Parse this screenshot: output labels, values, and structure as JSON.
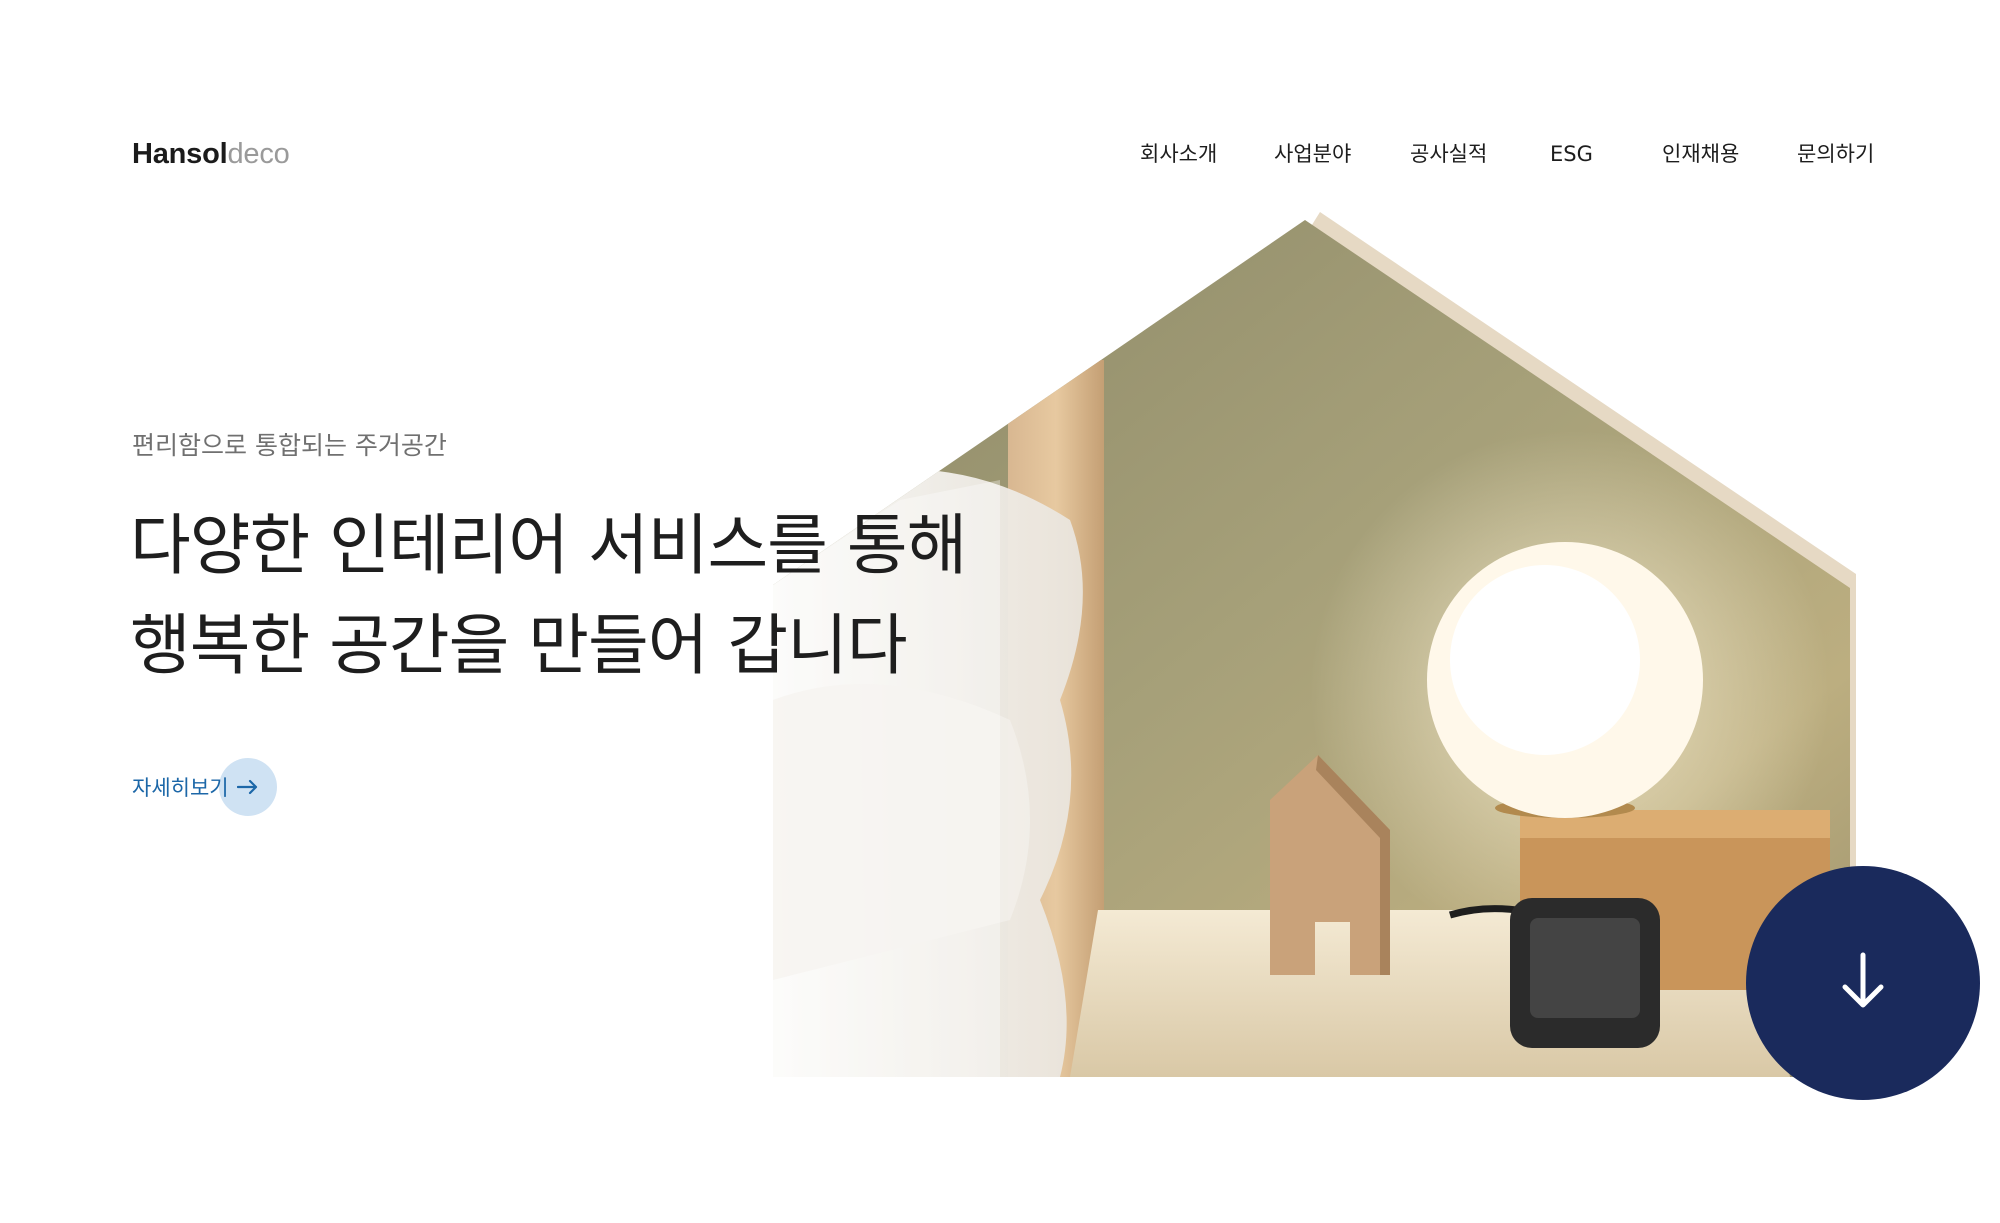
{
  "brand": {
    "logo_primary": "Hansol",
    "logo_secondary": "deco"
  },
  "nav": {
    "items": [
      {
        "label": "회사소개"
      },
      {
        "label": "사업분야"
      },
      {
        "label": "공사실적"
      },
      {
        "label": "ESG"
      },
      {
        "label": "인재채용"
      },
      {
        "label": "문의하기"
      }
    ]
  },
  "hero": {
    "eyebrow": "편리함으로 통합되는 주거공간",
    "headline_line1": "다양한 인테리어 서비스를 통해",
    "headline_line2": "행복한 공간을 만들어 갑니다",
    "more_label": "자세히보기",
    "more_icon": "arrow-right-icon",
    "image_icon": "house-shaped-photo"
  },
  "scroll": {
    "icon": "arrow-down-icon"
  },
  "colors": {
    "accent_blue": "#1c67a8",
    "button_circle": "#cfe2f3",
    "navy": "#1a2a5c",
    "house_frame": "#e6d9c4"
  }
}
